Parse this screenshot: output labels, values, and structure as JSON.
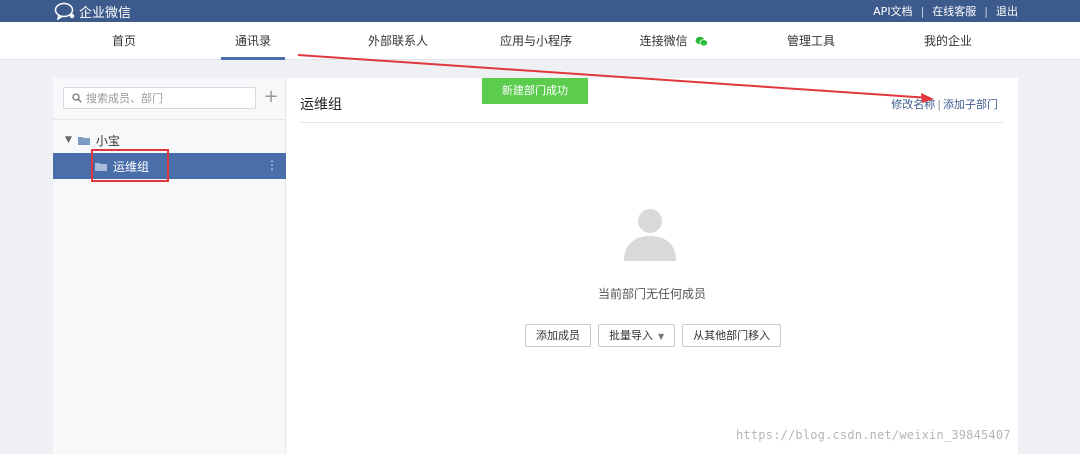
{
  "app": {
    "name": "企业微信"
  },
  "toplinks": {
    "api": "API文档",
    "support": "在线客服",
    "logout": "退出"
  },
  "nav": {
    "items": [
      {
        "label": "首页"
      },
      {
        "label": "通讯录"
      },
      {
        "label": "外部联系人"
      },
      {
        "label": "应用与小程序"
      },
      {
        "label": "连接微信"
      },
      {
        "label": "管理工具"
      },
      {
        "label": "我的企业"
      }
    ],
    "active": "通讯录"
  },
  "sidebar": {
    "search_placeholder": "搜索成员、部门",
    "add_label": "+",
    "tree": {
      "root": "小宝",
      "child": "运维组",
      "more_label": "⋮"
    }
  },
  "content": {
    "title": "运维组",
    "toast": "新建部门成功",
    "rename_label": "修改名称",
    "add_sub_label": "添加子部门",
    "empty_text": "当前部门无任何成员",
    "buttons": {
      "add_member": "添加成员",
      "batch_import": "批量导入",
      "move_from": "从其他部门移入"
    }
  },
  "watermark": "https://blog.csdn.net/weixin_39845407",
  "colors": {
    "header": "#3d5a8c",
    "accent": "#4a6ea9",
    "toast": "#5ccc4e",
    "annotation": "#e0383d"
  }
}
